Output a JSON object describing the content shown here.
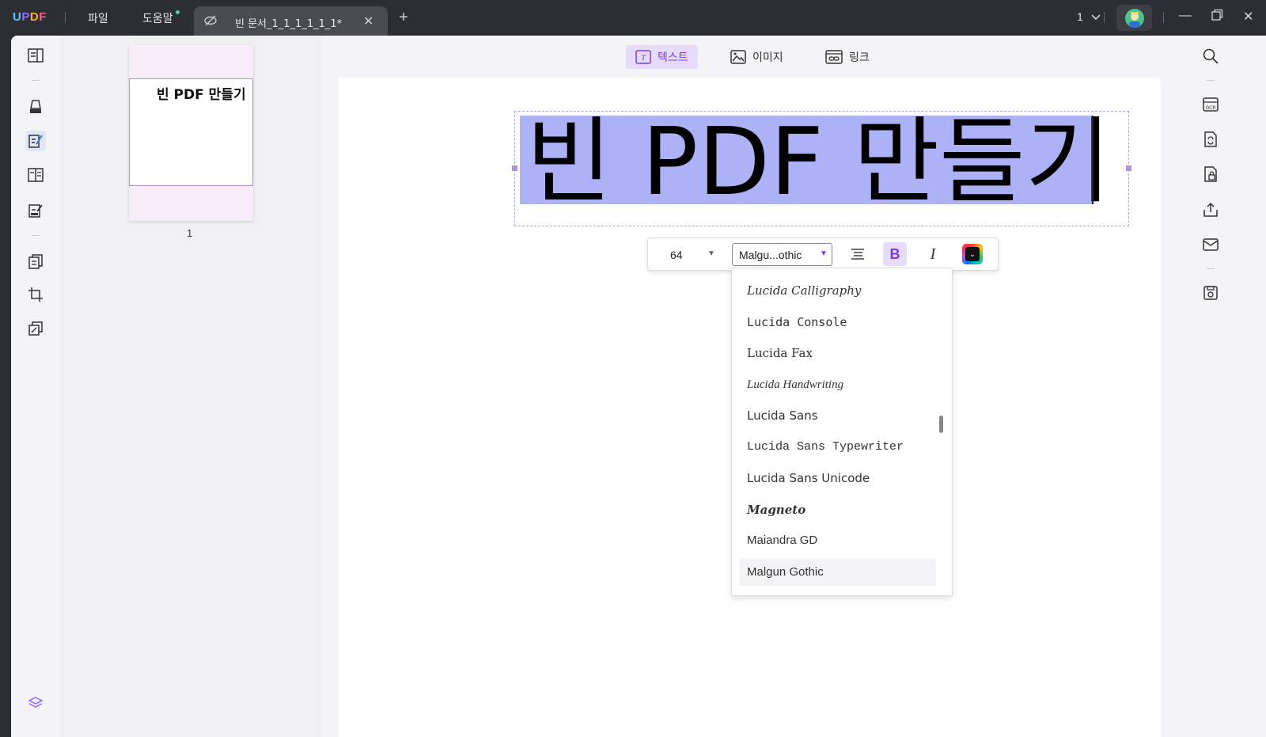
{
  "titlebar": {
    "logo": [
      "U",
      "P",
      "D",
      "F"
    ],
    "menu_file": "파일",
    "menu_help": "도움말",
    "tab_title": "빈 문서_1_1_1_1_1_1*",
    "page_indicator": "1"
  },
  "thumbnail": {
    "text": "빈 PDF 만들기",
    "page_number": "1"
  },
  "modes": {
    "text": "텍스트",
    "image": "이미지",
    "link": "링크"
  },
  "canvas": {
    "text": "빈 PDF 만들기"
  },
  "format_toolbar": {
    "font_size": "64",
    "font_name": "Malgu...othic",
    "bold_label": "B",
    "italic_label": "I"
  },
  "font_list": [
    "Lucida Calligraphy",
    "Lucida Console",
    "Lucida Fax",
    "Lucida Handwriting",
    "Lucida Sans",
    "Lucida Sans Typewriter",
    "Lucida Sans Unicode",
    "Magneto",
    "Maiandra GD",
    "Malgun Gothic"
  ],
  "font_list_selected": "Malgun Gothic",
  "colors": {
    "accent": "#7c3aed",
    "selection": "#adb1f5",
    "titlebar": "#2d2e33"
  }
}
